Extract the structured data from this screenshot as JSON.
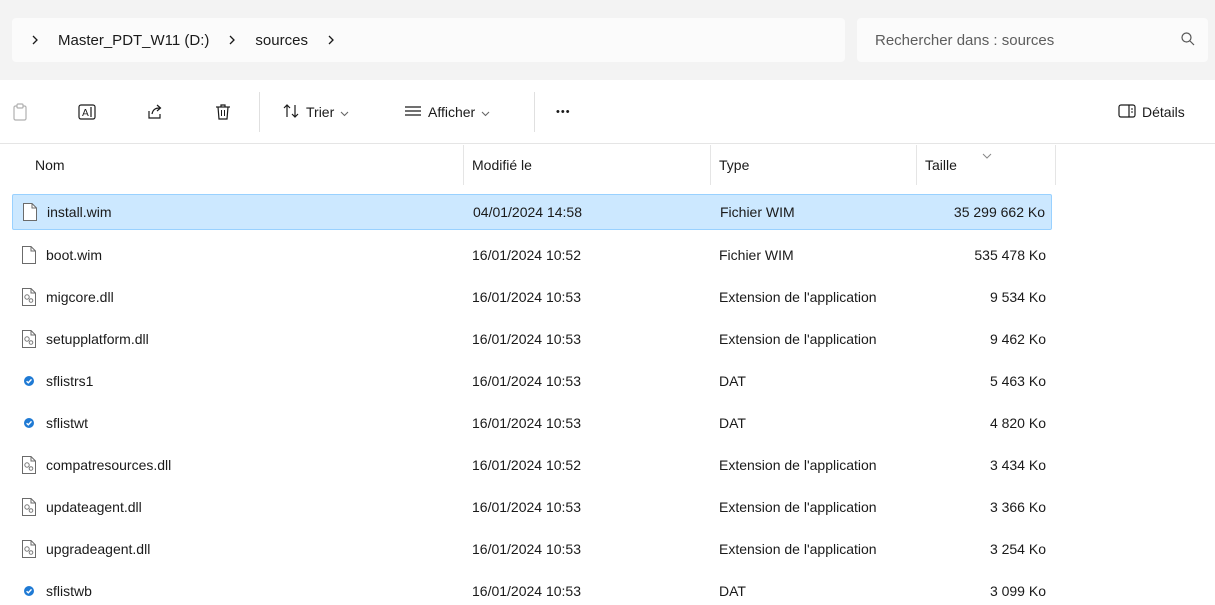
{
  "breadcrumb": {
    "items": [
      "Master_PDT_W11 (D:)",
      "sources"
    ]
  },
  "search": {
    "placeholder": "Rechercher dans : sources"
  },
  "toolbar": {
    "sort_label": "Trier",
    "view_label": "Afficher",
    "more_label": "•••",
    "details_label": "Détails"
  },
  "columns": {
    "name": "Nom",
    "date": "Modifié le",
    "type": "Type",
    "size": "Taille"
  },
  "files": [
    {
      "name": "install.wim",
      "date": "04/01/2024 14:58",
      "type": "Fichier WIM",
      "size": "35 299 662 Ko",
      "icon": "file-icon"
    },
    {
      "name": "boot.wim",
      "date": "16/01/2024 10:52",
      "type": "Fichier WIM",
      "size": "535 478 Ko",
      "icon": "file-icon"
    },
    {
      "name": "migcore.dll",
      "date": "16/01/2024 10:53",
      "type": "Extension de l'application",
      "size": "9 534 Ko",
      "icon": "dll-icon"
    },
    {
      "name": "setupplatform.dll",
      "date": "16/01/2024 10:53",
      "type": "Extension de l'application",
      "size": "9 462 Ko",
      "icon": "dll-icon"
    },
    {
      "name": "sflistrs1",
      "date": "16/01/2024 10:53",
      "type": "DAT",
      "size": "5 463 Ko",
      "icon": "dat-icon"
    },
    {
      "name": "sflistwt",
      "date": "16/01/2024 10:53",
      "type": "DAT",
      "size": "4 820 Ko",
      "icon": "dat-icon"
    },
    {
      "name": "compatresources.dll",
      "date": "16/01/2024 10:52",
      "type": "Extension de l'application",
      "size": "3 434 Ko",
      "icon": "dll-icon"
    },
    {
      "name": "updateagent.dll",
      "date": "16/01/2024 10:53",
      "type": "Extension de l'application",
      "size": "3 366 Ko",
      "icon": "dll-icon"
    },
    {
      "name": "upgradeagent.dll",
      "date": "16/01/2024 10:53",
      "type": "Extension de l'application",
      "size": "3 254 Ko",
      "icon": "dll-icon"
    },
    {
      "name": "sflistwb",
      "date": "16/01/2024 10:53",
      "type": "DAT",
      "size": "3 099 Ko",
      "icon": "dat-icon"
    }
  ],
  "colors": {
    "selection_bg": "#cce8ff",
    "selection_border": "#99d1ff",
    "dat_icon": "#1f7ad4"
  }
}
